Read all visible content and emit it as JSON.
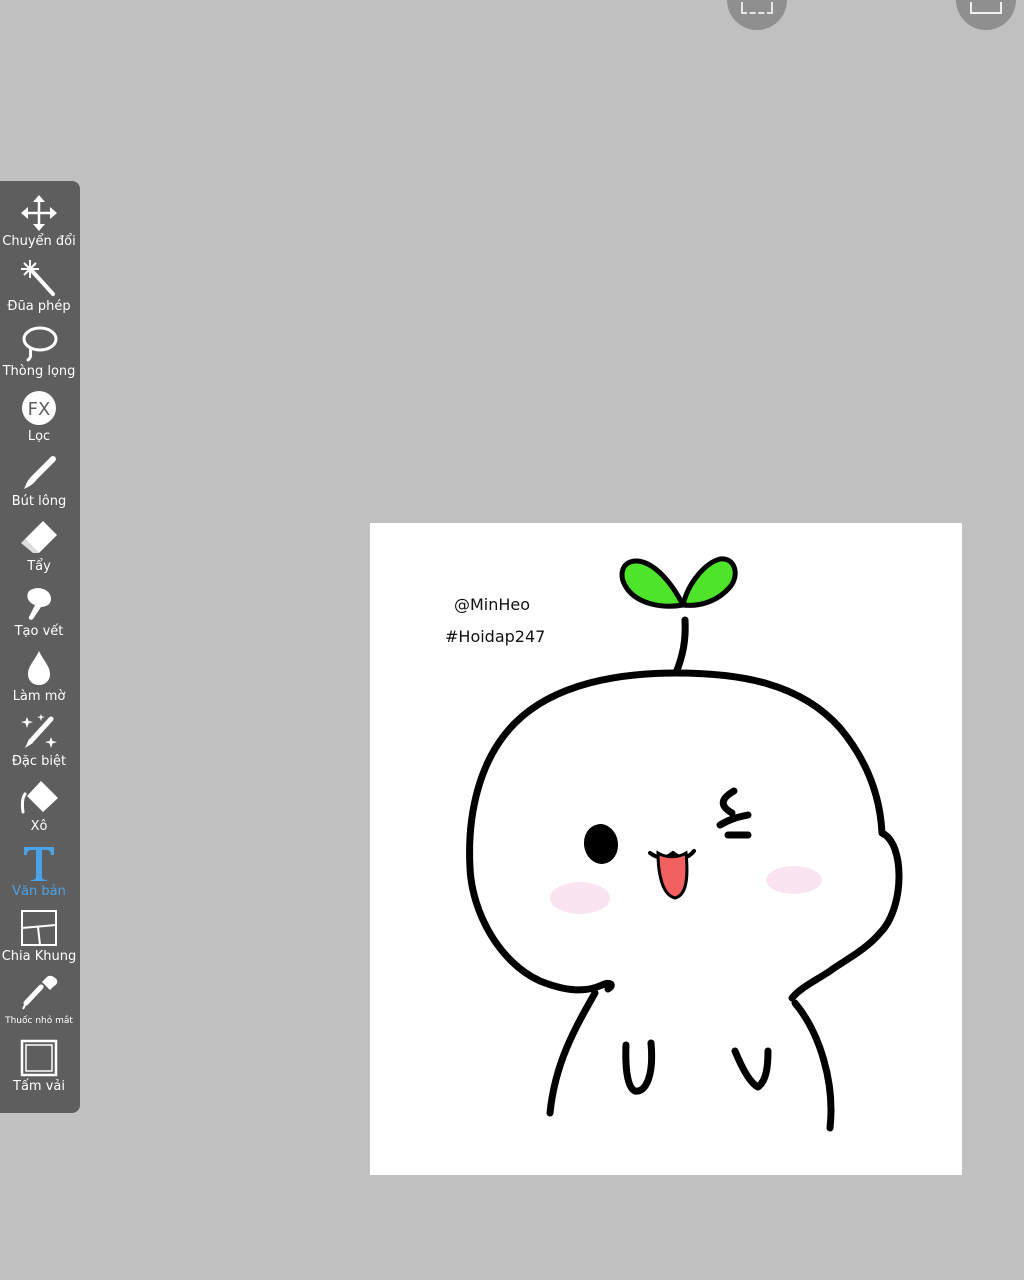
{
  "toolbar": {
    "tools": [
      {
        "label": "Chuyển đổi"
      },
      {
        "label": "Đũa phép"
      },
      {
        "label": "Thòng lọng"
      },
      {
        "label": "Lọc",
        "icon_text": "FX"
      },
      {
        "label": "Bút lông"
      },
      {
        "label": "Tẩy"
      },
      {
        "label": "Tạo vết"
      },
      {
        "label": "Làm mờ"
      },
      {
        "label": "Đặc biệt"
      },
      {
        "label": "Xô"
      },
      {
        "label": "Văn bản",
        "active": true
      },
      {
        "label": "Chia Khung"
      },
      {
        "label": "Thuốc nhỏ mắt"
      },
      {
        "label": "Tấm vải"
      }
    ]
  },
  "canvas": {
    "texts": {
      "author": "@MinHeo",
      "tag": "#Hoidap247"
    }
  },
  "colors": {
    "background": "#c0c0c0",
    "toolbar": "#5e5e5e",
    "active_tool": "#4aa3e8",
    "sprout": "#4ee42a",
    "tongue": "#f26060",
    "blush": "#fbe4f1"
  }
}
